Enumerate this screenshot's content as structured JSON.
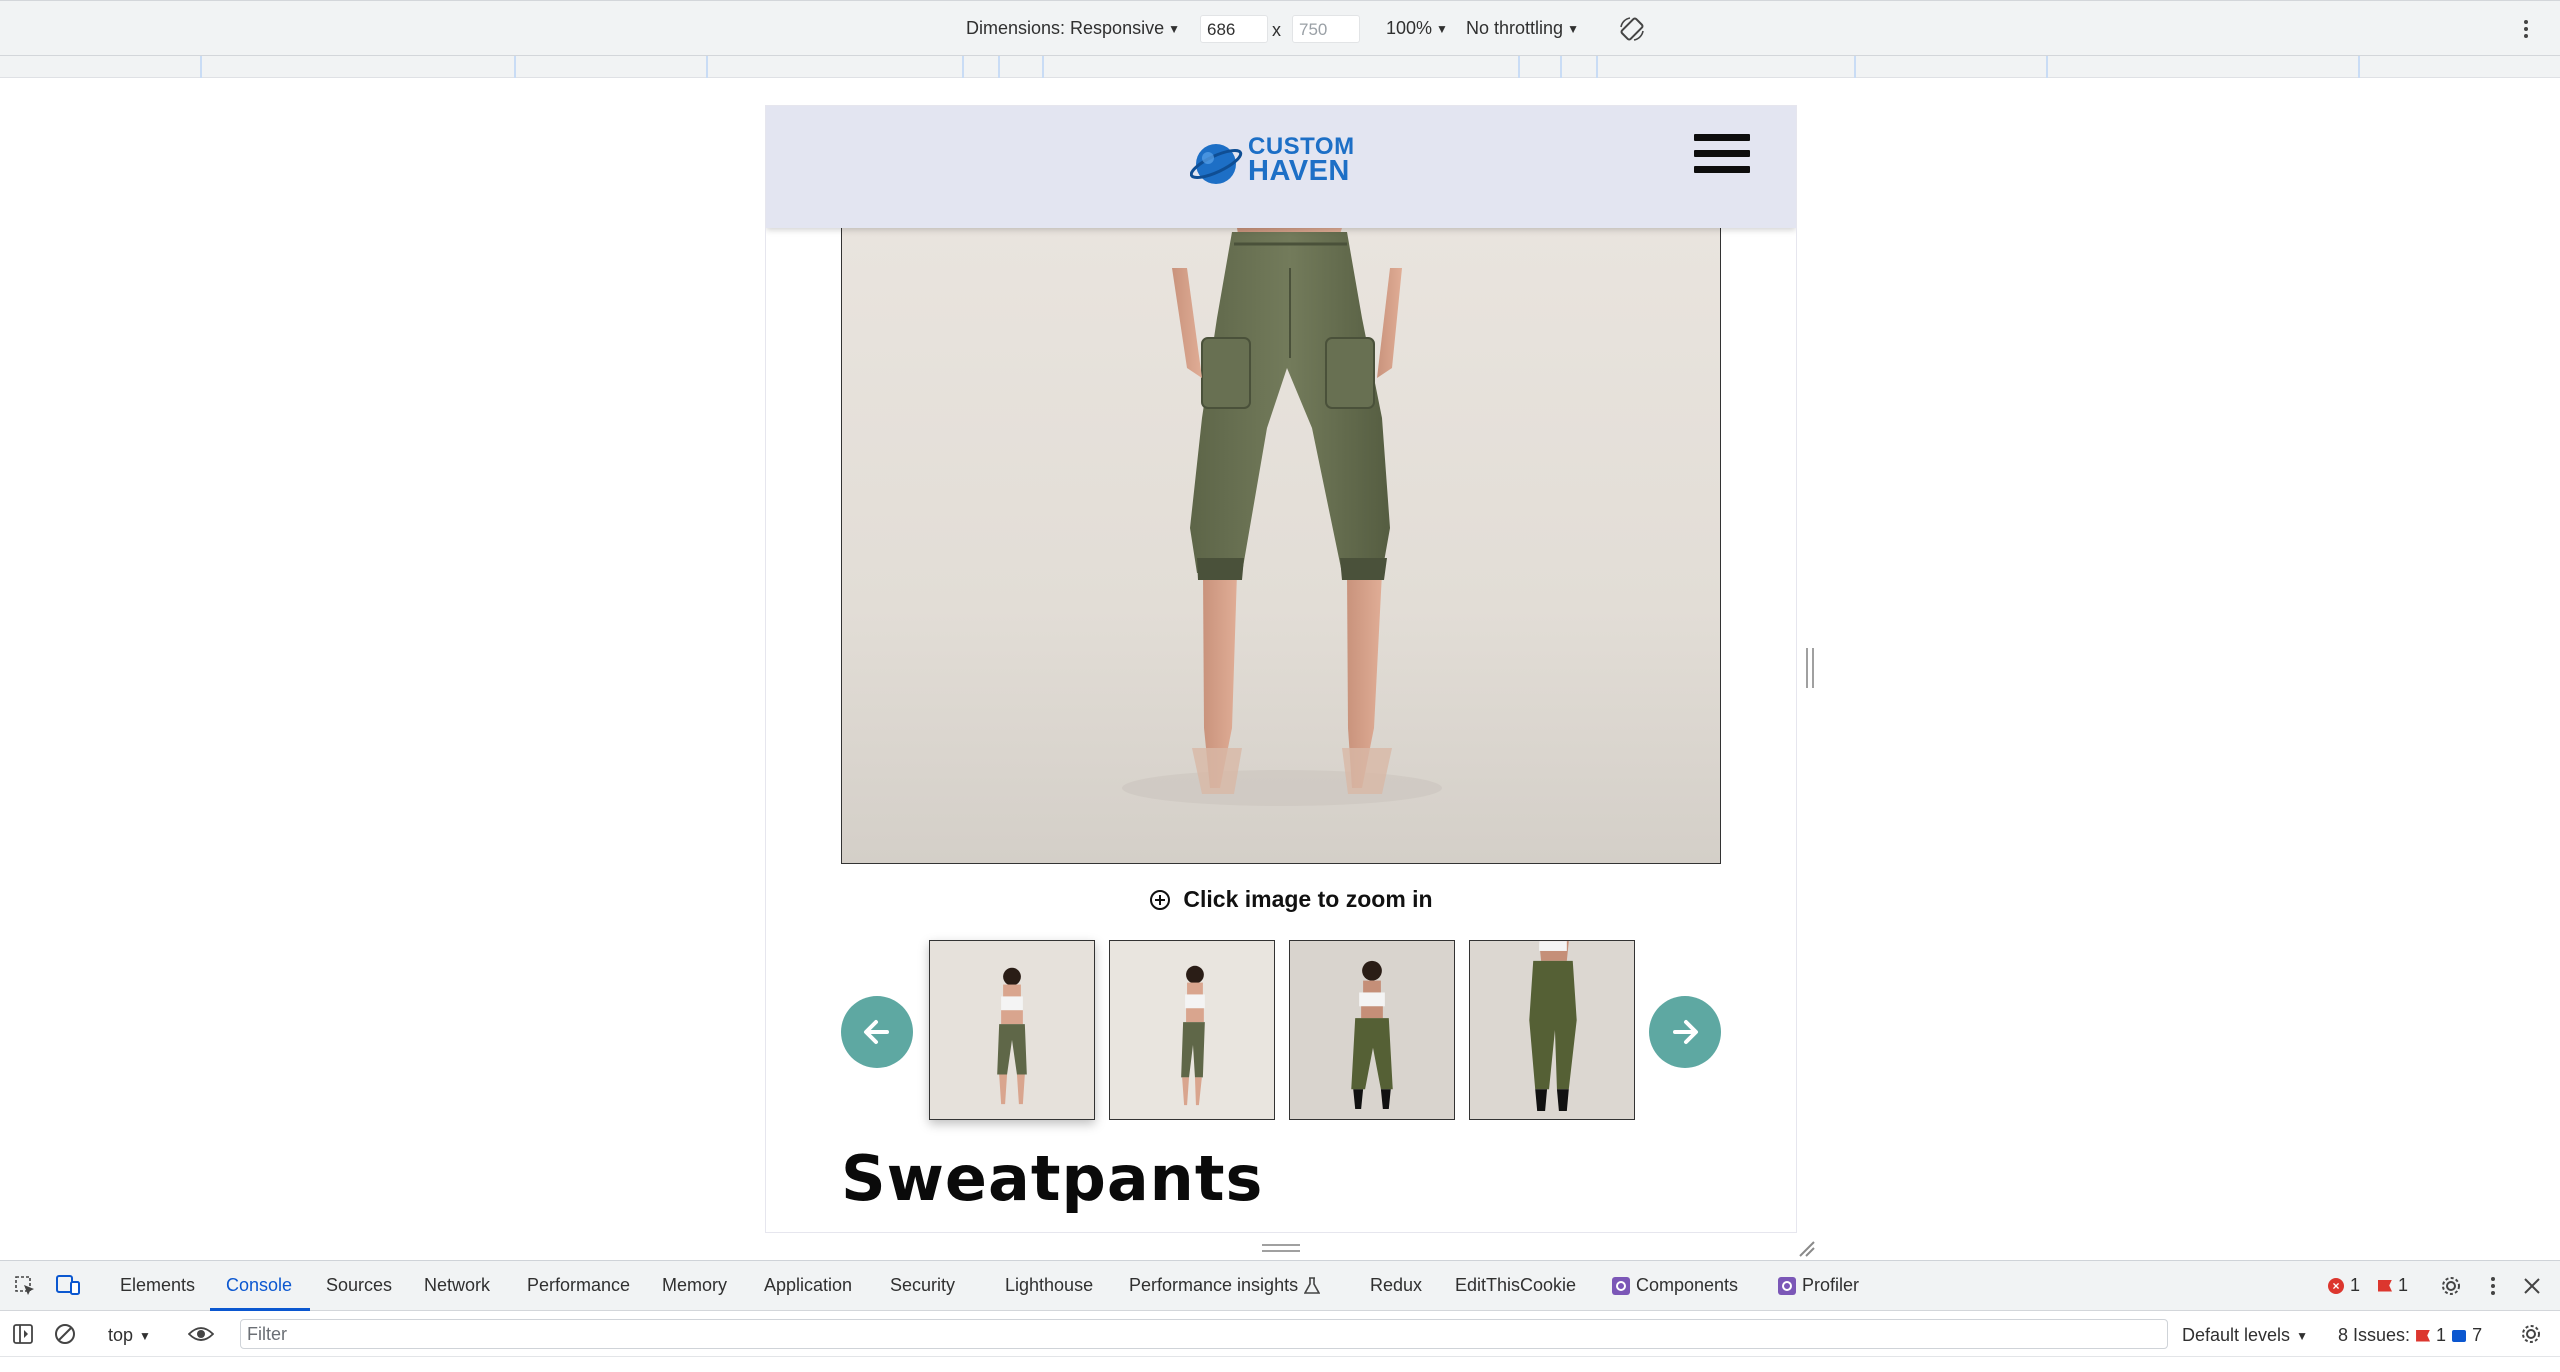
{
  "device_toolbar": {
    "dimensions_label": "Dimensions: Responsive",
    "width_value": "686",
    "height_placeholder": "750",
    "times": "x",
    "zoom": "100%",
    "throttling": "No throttling"
  },
  "site": {
    "logo_line1": "CUSTOM",
    "logo_line2": "HAVEN",
    "zoom_hint": "Click image to zoom in",
    "product_title": "Sweatpants",
    "accent_color": "#5ea8a2",
    "header_color": "#e3e5f1",
    "logo_color": "#1d6fc6",
    "thumbnails": [
      "thumbnail-1",
      "thumbnail-2",
      "thumbnail-3",
      "thumbnail-4"
    ]
  },
  "devtools": {
    "tabs": [
      "Elements",
      "Console",
      "Sources",
      "Network",
      "Performance",
      "Memory",
      "Application",
      "Security",
      "Lighthouse",
      "Performance insights",
      "Redux",
      "EditThisCookie",
      "Components",
      "Profiler"
    ],
    "active_tab": "Console",
    "error_count": "1",
    "warning_count": "1",
    "context": "top",
    "filter_placeholder": "Filter",
    "levels": "Default levels",
    "issues_label": "8 Issues:",
    "issues_errors": "1",
    "issues_info": "7"
  }
}
